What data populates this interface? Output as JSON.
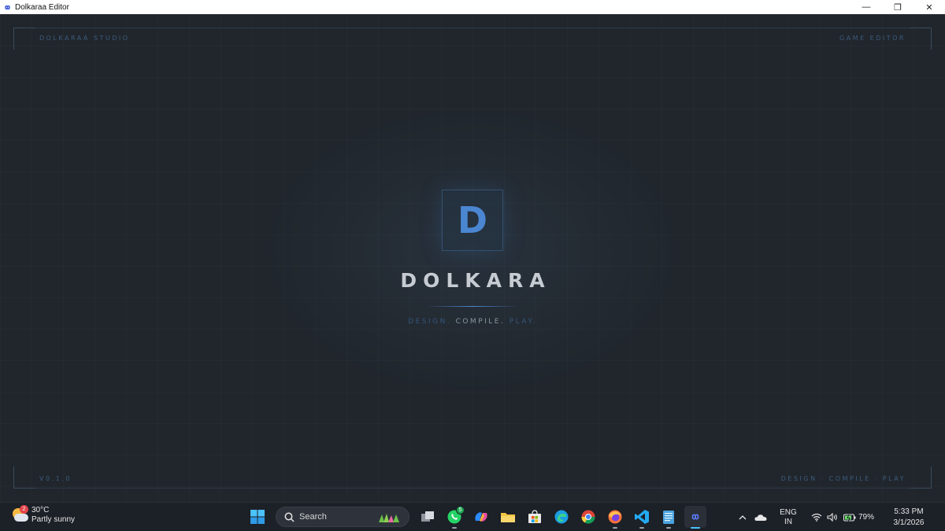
{
  "window": {
    "title": "Dolkaraa Editor",
    "controls": {
      "minimize": "—",
      "restore": "❐",
      "close": "✕"
    }
  },
  "splash": {
    "corner_top_left": "DOLKARAA STUDIO",
    "corner_top_right": "GAME EDITOR",
    "corner_bottom_left": "V0.1.0",
    "corner_bottom_right": "DESIGN · COMPILE · PLAY",
    "logo_letter": "D",
    "brand_name": "DOLKARA",
    "tagline": {
      "part1": "DESIGN.",
      "part2": "COMPILE.",
      "part3": "PLAY."
    },
    "colors": {
      "accent": "#4a86d1",
      "background": "#20262c",
      "text": "#c7ccd3"
    }
  },
  "taskbar": {
    "weather": {
      "temperature": "30°C",
      "condition": "Partly sunny",
      "notification_count": "2"
    },
    "search": {
      "placeholder": "Search"
    },
    "pinned": [
      {
        "name": "task-view",
        "icon": "task-view-icon"
      },
      {
        "name": "whatsapp",
        "icon": "whatsapp-icon",
        "badge": "5"
      },
      {
        "name": "copilot",
        "icon": "copilot-icon"
      },
      {
        "name": "file-explorer",
        "icon": "folder-icon"
      },
      {
        "name": "microsoft-store",
        "icon": "store-icon"
      },
      {
        "name": "edge",
        "icon": "edge-icon"
      },
      {
        "name": "chrome",
        "icon": "chrome-icon"
      },
      {
        "name": "firefox",
        "icon": "firefox-icon"
      },
      {
        "name": "vscode",
        "icon": "vscode-icon"
      },
      {
        "name": "notepad",
        "icon": "notepad-icon"
      },
      {
        "name": "dolkaraa-editor",
        "icon": "dolkaraa-icon"
      }
    ],
    "tray": {
      "language_line1": "ENG",
      "language_line2": "IN",
      "battery_percent": "79%",
      "time": "5:33 PM",
      "date": "3/1/2026"
    }
  }
}
